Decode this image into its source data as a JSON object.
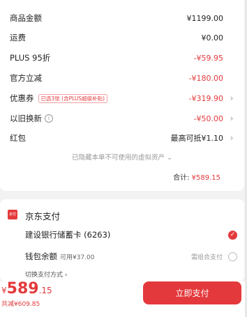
{
  "summary": {
    "rows": [
      {
        "label": "商品金额",
        "value": "¥1199.00"
      },
      {
        "label": "运费",
        "value": "¥0.00"
      },
      {
        "label": "PLUS 95折",
        "value": "-¥59.95"
      },
      {
        "label": "官方立减",
        "value": "-¥180.00"
      },
      {
        "label": "优惠券",
        "badge": "已选3张 (含PLUS超级补贴)",
        "value": "-¥319.90"
      },
      {
        "label": "以旧换新",
        "value": "-¥50.00"
      },
      {
        "label": "红包",
        "value": "最高可抵¥1.10"
      }
    ],
    "hidden_assets": "已隐藏本单不可使用的虚拟资产",
    "total_label": "合计:",
    "total_amount": "¥589.15"
  },
  "payment": {
    "title": "京东支付",
    "icon_text": "京付",
    "bank_card": "建设银行储蓄卡 (6263)",
    "wallet_label": "钱包余额",
    "wallet_available": "可用¥37.00",
    "combo_hint": "需组合支付",
    "switch_method": "切换支付方式"
  },
  "footer": {
    "currency": "¥",
    "amount_int": "589",
    "amount_dec": ".15",
    "total_sum": "共减¥609.85",
    "pay_button": "立即支付"
  },
  "colors": {
    "accent": "#e4393c",
    "background": "#f2f2f2"
  }
}
